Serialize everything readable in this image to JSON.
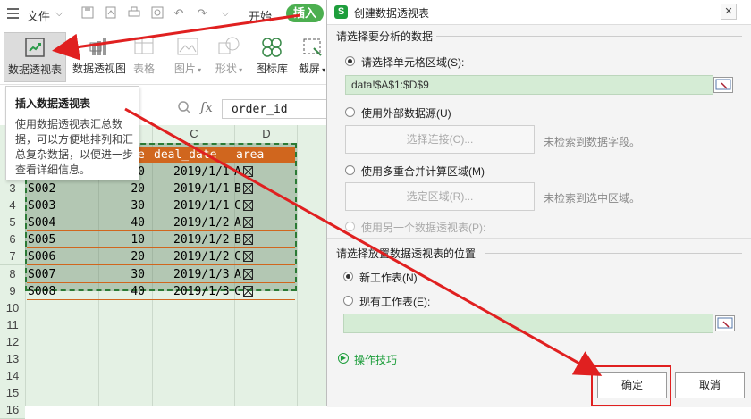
{
  "toolbar": {
    "file_label": "文件",
    "tabs": [
      "开始",
      "插入"
    ],
    "active_tab": "插入",
    "active_tab_color": "#4caf50"
  },
  "ribbon": {
    "buttons": [
      {
        "label": "数据透视表",
        "icon": "pivot-table-icon",
        "highlighted": true
      },
      {
        "label": "数据透视图",
        "icon": "pivot-chart-icon"
      },
      {
        "label": "表格",
        "icon": "table-icon",
        "disabled": true
      },
      {
        "label": "图片",
        "icon": "picture-icon",
        "dropdown": true,
        "disabled": true
      },
      {
        "label": "形状",
        "icon": "shapes-icon",
        "dropdown": true,
        "disabled": true
      },
      {
        "label": "图标库",
        "icon": "icon-library-icon"
      },
      {
        "label": "截屏",
        "icon": "screenshot-icon",
        "dropdown": true
      }
    ]
  },
  "tooltip": {
    "title": "插入数据透视表",
    "body": "使用数据透视表汇总数据，可以方便地排列和汇总复杂数据，以便进一步查看详细信息。"
  },
  "formula_bar": {
    "fx_label": "fx",
    "cell_content": "order_id"
  },
  "sheet": {
    "columns": [
      "C",
      "D"
    ],
    "header_row": {
      "b_tail": "e",
      "c": "deal_date",
      "d": "area"
    },
    "header_fill": "#d0661e",
    "rows": [
      {
        "num": "3",
        "a": "S002",
        "b": "20",
        "c": "2019/1/1",
        "d": "B"
      },
      {
        "num": "4",
        "a": "S003",
        "b": "30",
        "c": "2019/1/1",
        "d": "C"
      },
      {
        "num": "5",
        "a": "S004",
        "b": "40",
        "c": "2019/1/2",
        "d": "A"
      },
      {
        "num": "6",
        "a": "S005",
        "b": "10",
        "c": "2019/1/2",
        "d": "B"
      },
      {
        "num": "7",
        "a": "S006",
        "b": "20",
        "c": "2019/1/2",
        "d": "C"
      },
      {
        "num": "8",
        "a": "S007",
        "b": "30",
        "c": "2019/1/3",
        "d": "A"
      },
      {
        "num": "9",
        "a": "S008",
        "b": "40",
        "c": "2019/1/3",
        "d": "C"
      }
    ],
    "row2_partial": {
      "b": "10",
      "c": "2019/1/1",
      "d": "A"
    },
    "empty_rows": [
      "10",
      "11",
      "12",
      "13",
      "14",
      "15",
      "16"
    ]
  },
  "dialog": {
    "title": "创建数据透视表",
    "section1_title": "请选择要分析的数据",
    "opt_range_label": "请选择单元格区域(S):",
    "range_value": "data!$A$1:$D$9",
    "opt_external_label": "使用外部数据源(U)",
    "select_connection_label": "选择连接(C)...",
    "no_field_hint": "未检索到数据字段。",
    "opt_multi_label": "使用多重合并计算区域(M)",
    "select_region_label": "选定区域(R)...",
    "no_region_hint": "未检索到选中区域。",
    "opt_another_label": "使用另一个数据透视表(P):",
    "section2_title": "请选择放置数据透视表的位置",
    "opt_new_sheet_label": "新工作表(N)",
    "opt_existing_label": "现有工作表(E):",
    "tips_label": "操作技巧",
    "ok_label": "确定",
    "cancel_label": "取消",
    "accent_color": "#1e9e3c"
  },
  "annotation_color": "#e02020"
}
